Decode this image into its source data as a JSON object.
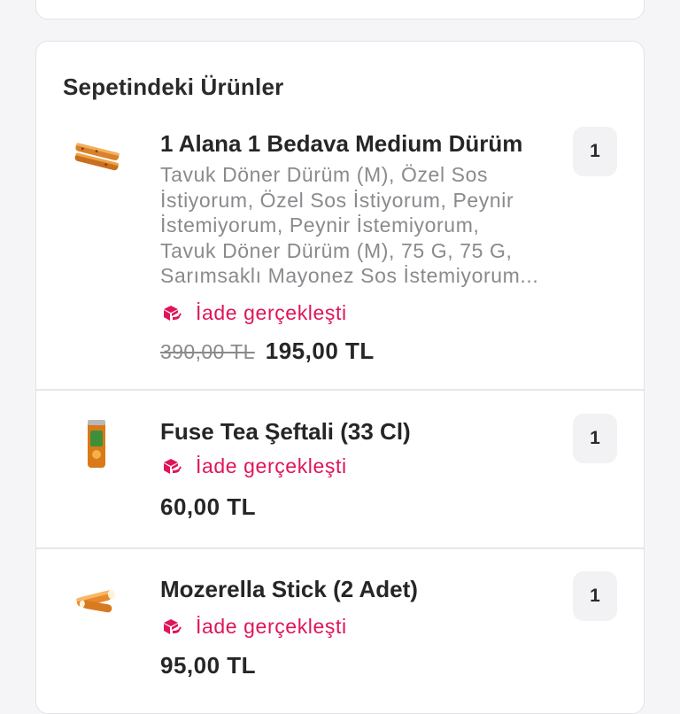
{
  "cart": {
    "title": "Sepetindeki Ürünler",
    "items": [
      {
        "name": "1 Alana 1 Bedava Medium Dürüm",
        "description_lines": [
          "Tavuk Döner Dürüm  (M), Özel Sos",
          "İstiyorum, Özel Sos İstiyorum, Peynir",
          "İstemiyorum, Peynir İstemiyorum,",
          "Tavuk Döner Dürüm  (M), 75 G, 75 G,",
          "Sarımsaklı Mayonez Sos İstemiyorum..."
        ],
        "status": "İade gerçekleşti",
        "old_price": "390,00 TL",
        "price": "195,00 TL",
        "quantity": "1",
        "thumb_icon": "wrap-food-icon"
      },
      {
        "name": "Fuse Tea Şeftali (33 Cl)",
        "status": "İade gerçekleşti",
        "price": "60,00 TL",
        "quantity": "1",
        "thumb_icon": "drink-can-icon"
      },
      {
        "name": "Mozerella Stick (2 Adet)",
        "status": "İade gerçekleşti",
        "price": "95,00 TL",
        "quantity": "1",
        "thumb_icon": "mozzarella-stick-icon"
      }
    ]
  },
  "colors": {
    "status": "#e0145a",
    "muted_text": "#8a8a8e",
    "card_border": "#e3e3e7"
  }
}
